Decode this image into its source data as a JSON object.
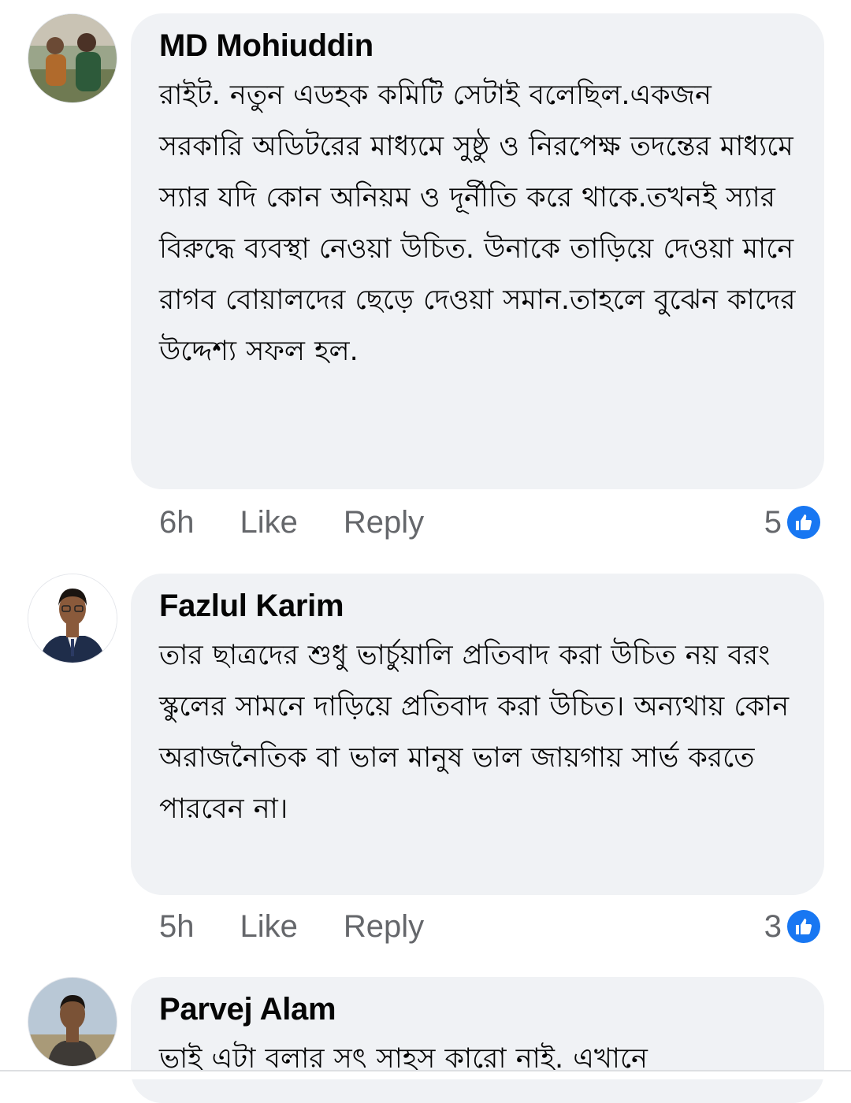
{
  "comments": [
    {
      "author": "MD Mohiuddin",
      "text": "রাইট. নতুন এডহক কমিটি  সেটাই বলেছিল.একজন সরকারি অডিটরের মাধ্যমে সুষ্ঠু ও নিরপেক্ষ তদন্তের মাধ্যমে স্যার যদি কোন অনিয়ম ও দূর্নীতি করে থাকে.তখনই স্যার বিরুদ্ধে ব্যবস্থা নেওয়া উচিত. উনাকে তাড়িয়ে দেওয়া মানে রাগব বোয়ালদের ছেড়ে দেওয়া সমান.তাহলে বুঝেন কাদের উদ্দেশ্য সফল হল.",
      "time": "6h",
      "like_label": "Like",
      "reply_label": "Reply",
      "reaction_count": "5",
      "reaction_icon": "like-icon"
    },
    {
      "author": "Fazlul Karim",
      "text": "তার ছাত্রদের শুধু ভার্চুয়ালি প্রতিবাদ করা উচিত নয় বরং স্কুলের সামনে দাড়িয়ে প্রতিবাদ করা উচিত। অন্যথায় কোন অরাজনৈতিক বা ভাল মানুষ ভাল জায়গায় সার্ভ করতে পারবেন না।",
      "time": "5h",
      "like_label": "Like",
      "reply_label": "Reply",
      "reaction_count": "3",
      "reaction_icon": "like-icon"
    },
    {
      "author": "Parvej Alam",
      "text": "ভাই এটা বলার সৎ সাহস  কারো নাই. এখানে"
    }
  ],
  "colors": {
    "bubble": "#f0f2f5",
    "meta_text": "#65676b",
    "like_blue": "#1877f2"
  }
}
